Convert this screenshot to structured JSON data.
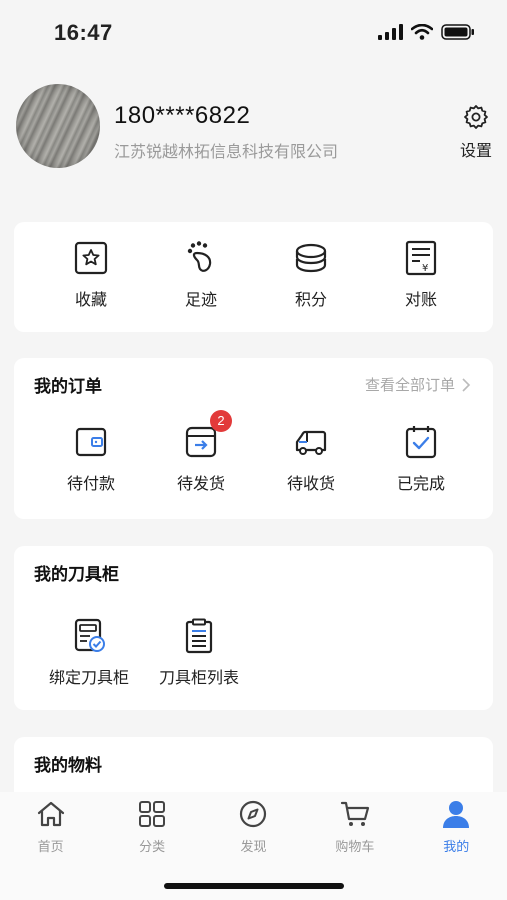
{
  "status_bar": {
    "time": "16:47"
  },
  "profile": {
    "phone": "180****6822",
    "company": "江苏锐越林拓信息科技有限公司",
    "settings_label": "设置"
  },
  "quick_actions": [
    {
      "label": "收藏",
      "icon": "star-box-icon"
    },
    {
      "label": "足迹",
      "icon": "footprint-icon"
    },
    {
      "label": "积分",
      "icon": "coins-icon"
    },
    {
      "label": "对账",
      "icon": "statement-icon"
    }
  ],
  "orders": {
    "title": "我的订单",
    "view_all": "查看全部订单",
    "items": [
      {
        "label": "待付款",
        "icon": "wallet-icon"
      },
      {
        "label": "待发货",
        "icon": "ship-box-icon",
        "badge": "2"
      },
      {
        "label": "待收货",
        "icon": "truck-icon"
      },
      {
        "label": "已完成",
        "icon": "calendar-check-icon"
      }
    ]
  },
  "cabinet": {
    "title": "我的刀具柜",
    "items": [
      {
        "label": "绑定刀具柜",
        "icon": "bind-cabinet-icon"
      },
      {
        "label": "刀具柜列表",
        "icon": "cabinet-list-icon"
      }
    ]
  },
  "materials": {
    "title": "我的物料"
  },
  "tabbar": {
    "accent": "#3b7ee8",
    "tabs": [
      {
        "label": "首页",
        "icon": "home-icon",
        "active": false
      },
      {
        "label": "分类",
        "icon": "grid-icon",
        "active": false
      },
      {
        "label": "发现",
        "icon": "compass-icon",
        "active": false
      },
      {
        "label": "购物车",
        "icon": "cart-icon",
        "active": false
      },
      {
        "label": "我的",
        "icon": "person-icon",
        "active": true
      }
    ]
  }
}
